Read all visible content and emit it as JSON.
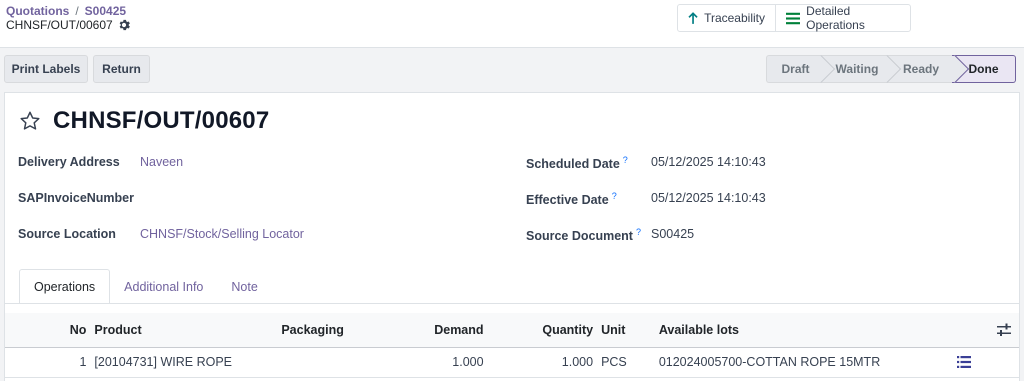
{
  "breadcrumb": {
    "parent": "Quotations",
    "separator": "/",
    "current": "S00425"
  },
  "record": {
    "name": "CHNSF/OUT/00607"
  },
  "smart_buttons": {
    "traceability": "Traceability",
    "detailed_operations": "Detailed Operations"
  },
  "actions": {
    "print_labels": "Print Labels",
    "return": "Return"
  },
  "statusbar": {
    "stages": [
      "Draft",
      "Waiting",
      "Ready",
      "Done"
    ],
    "active": "Done"
  },
  "form": {
    "title": "CHNSF/OUT/00607",
    "delivery_address_label": "Delivery Address",
    "delivery_address": "Naveen",
    "sap_invoice_label": "SAPInvoiceNumber",
    "sap_invoice": "",
    "source_location_label": "Source Location",
    "source_location": "CHNSF/Stock/Selling Locator",
    "scheduled_date_label": "Scheduled Date",
    "scheduled_date": "05/12/2025 14:10:43",
    "effective_date_label": "Effective Date",
    "effective_date": "05/12/2025 14:10:43",
    "source_document_label": "Source Document",
    "source_document": "S00425",
    "help_mark": "?"
  },
  "tabs": [
    "Operations",
    "Additional Info",
    "Note"
  ],
  "operations": {
    "columns": {
      "no": "No",
      "product": "Product",
      "packaging": "Packaging",
      "demand": "Demand",
      "quantity": "Quantity",
      "unit": "Unit",
      "available_lots": "Available lots"
    },
    "rows": [
      {
        "no": "1",
        "product": "[20104731] WIRE ROPE",
        "packaging": "",
        "demand": "1.000",
        "quantity": "1.000",
        "unit": "PCS",
        "available_lots": "012024005700-COTTAN ROPE 15MTR"
      }
    ]
  },
  "colors": {
    "accent": "#71639e",
    "traceability_arrow": "#017e84",
    "detailed_ops_icon": "#00813a"
  }
}
